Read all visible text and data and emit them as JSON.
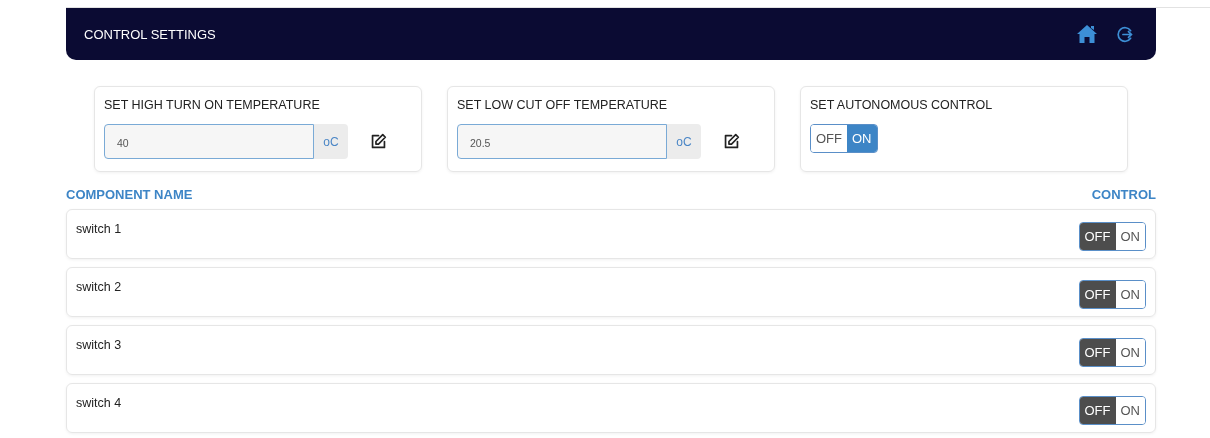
{
  "header": {
    "title": "CONTROL SETTINGS"
  },
  "settings": [
    {
      "kind": "temperature",
      "label": "SET HIGH TURN ON TEMPERATURE",
      "value": "40",
      "unit": "oC"
    },
    {
      "kind": "temperature",
      "label": "SET LOW CUT OFF TEMPERATURE",
      "value": "20.5",
      "unit": "oC"
    },
    {
      "kind": "toggle",
      "label": "SET AUTONOMOUS CONTROL",
      "off_label": "OFF",
      "on_label": "ON",
      "on": true
    }
  ],
  "table": {
    "columns": [
      "COMPONENT NAME",
      "CONTROL"
    ],
    "rows": [
      {
        "name": "switch 1",
        "off_label": "OFF",
        "on_label": "ON",
        "on": false
      },
      {
        "name": "switch 2",
        "off_label": "OFF",
        "on_label": "ON",
        "on": false
      },
      {
        "name": "switch 3",
        "off_label": "OFF",
        "on_label": "ON",
        "on": false
      },
      {
        "name": "switch 4",
        "off_label": "OFF",
        "on_label": "ON",
        "on": false
      }
    ]
  }
}
